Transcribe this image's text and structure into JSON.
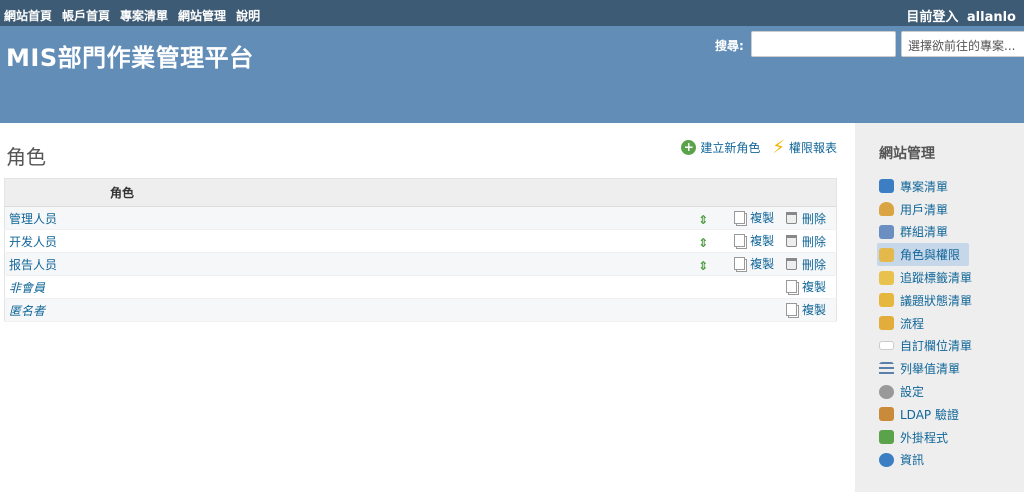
{
  "top_menu": {
    "links": [
      "網站首頁",
      "帳戶首頁",
      "專案清單",
      "網站管理",
      "說明"
    ],
    "login_label": "目前登入",
    "user": "allanlo"
  },
  "header": {
    "title": "MIS部門作業管理平台",
    "search_label": "搜尋:",
    "search_value": "",
    "project_select": "選擇欲前往的專案..."
  },
  "main": {
    "page_title": "角色",
    "new_role": "建立新角色",
    "permissions_report": "權限報表",
    "table_header": "角色",
    "copy_label": "複製",
    "delete_label": "刪除",
    "roles": [
      {
        "name": "管理人员",
        "builtin": false
      },
      {
        "name": "开发人员",
        "builtin": false
      },
      {
        "name": "报告人员",
        "builtin": false
      },
      {
        "name": "非會員",
        "builtin": true
      },
      {
        "name": "匿名者",
        "builtin": true
      }
    ]
  },
  "sidebar": {
    "title": "網站管理",
    "items": [
      {
        "label": "專案清單",
        "icon": "projects-icon",
        "color": "#3c7ec4"
      },
      {
        "label": "用戶清單",
        "icon": "user-icon",
        "color": "#d9a441"
      },
      {
        "label": "群組清單",
        "icon": "group-icon",
        "color": "#6a8fc0"
      },
      {
        "label": "角色與權限",
        "icon": "role-icon",
        "color": "#e5b84b",
        "selected": true
      },
      {
        "label": "追蹤標籤清單",
        "icon": "tracker-icon",
        "color": "#e9c24e"
      },
      {
        "label": "議題狀態清單",
        "icon": "status-icon",
        "color": "#e6b73e"
      },
      {
        "label": "流程",
        "icon": "workflow-icon",
        "color": "#e2ad3a"
      },
      {
        "label": "自訂欄位清單",
        "icon": "custom-field-icon",
        "color": "#ffffff"
      },
      {
        "label": "列舉值清單",
        "icon": "list-icon",
        "color": "#5a7fa8"
      },
      {
        "label": "設定",
        "icon": "gear-icon",
        "color": "#999999"
      },
      {
        "label": "LDAP 驗證",
        "icon": "ldap-icon",
        "color": "#c98a3a"
      },
      {
        "label": "外掛程式",
        "icon": "plugin-icon",
        "color": "#5aa34a"
      },
      {
        "label": "資訊",
        "icon": "info-icon",
        "color": "#3c7ec4"
      }
    ]
  }
}
